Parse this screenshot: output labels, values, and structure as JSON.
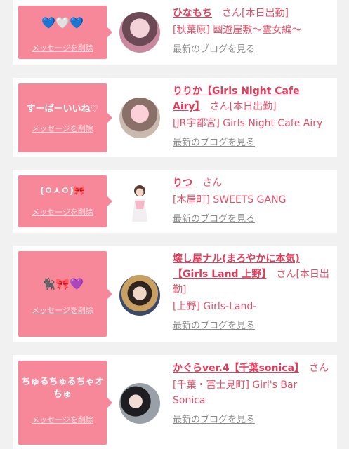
{
  "cards": [
    {
      "message": "💙🤍💙",
      "delete_label": "メッセージを削除",
      "name": "ひなもち",
      "suffix": "さん",
      "status": "[本日出勤]",
      "shop": "[秋葉原] 幽遊屋敷〜霊女編〜",
      "blog_label": "最新のブログを見る"
    },
    {
      "message": "すーぱーいいね♡",
      "delete_label": "メッセージを削除",
      "name": "りりか【Girls Night Cafe Airy】",
      "suffix": "さん",
      "status": "[本日出勤]",
      "shop": "[JR宇都宮] Girls Night Cafe Airy",
      "blog_label": "最新のブログを見る"
    },
    {
      "message": "(ㅇㅅㅇ)🎀",
      "delete_label": "メッセージを削除",
      "name": "りつ",
      "suffix": "さん",
      "status": "",
      "shop": "[木屋町] SWEETS GANG",
      "blog_label": "最新のブログを見る"
    },
    {
      "message": "🐈‍⬛🎀💜",
      "delete_label": "メッセージを削除",
      "name": "壊し屋ナル(まろやかに本気)【Girls Land 上野】",
      "suffix": "さん",
      "status": "[本日出勤]",
      "shop": "[上野] Girls-Land-",
      "blog_label": "最新のブログを見る"
    },
    {
      "message": "ちゅるちゅるちゃオちゅ",
      "delete_label": "メッセージを削除",
      "name": "かぐらver.4【千葉sonica】",
      "suffix": "さん",
      "status": "",
      "shop": "[千葉・富士見町] Girl's Bar Sonica",
      "blog_label": "最新のブログを見る"
    }
  ],
  "colors": {
    "accent": "#f7889a",
    "name": "#e23c5b",
    "muted": "#8a8a8a",
    "background": "#f1f1f1"
  }
}
